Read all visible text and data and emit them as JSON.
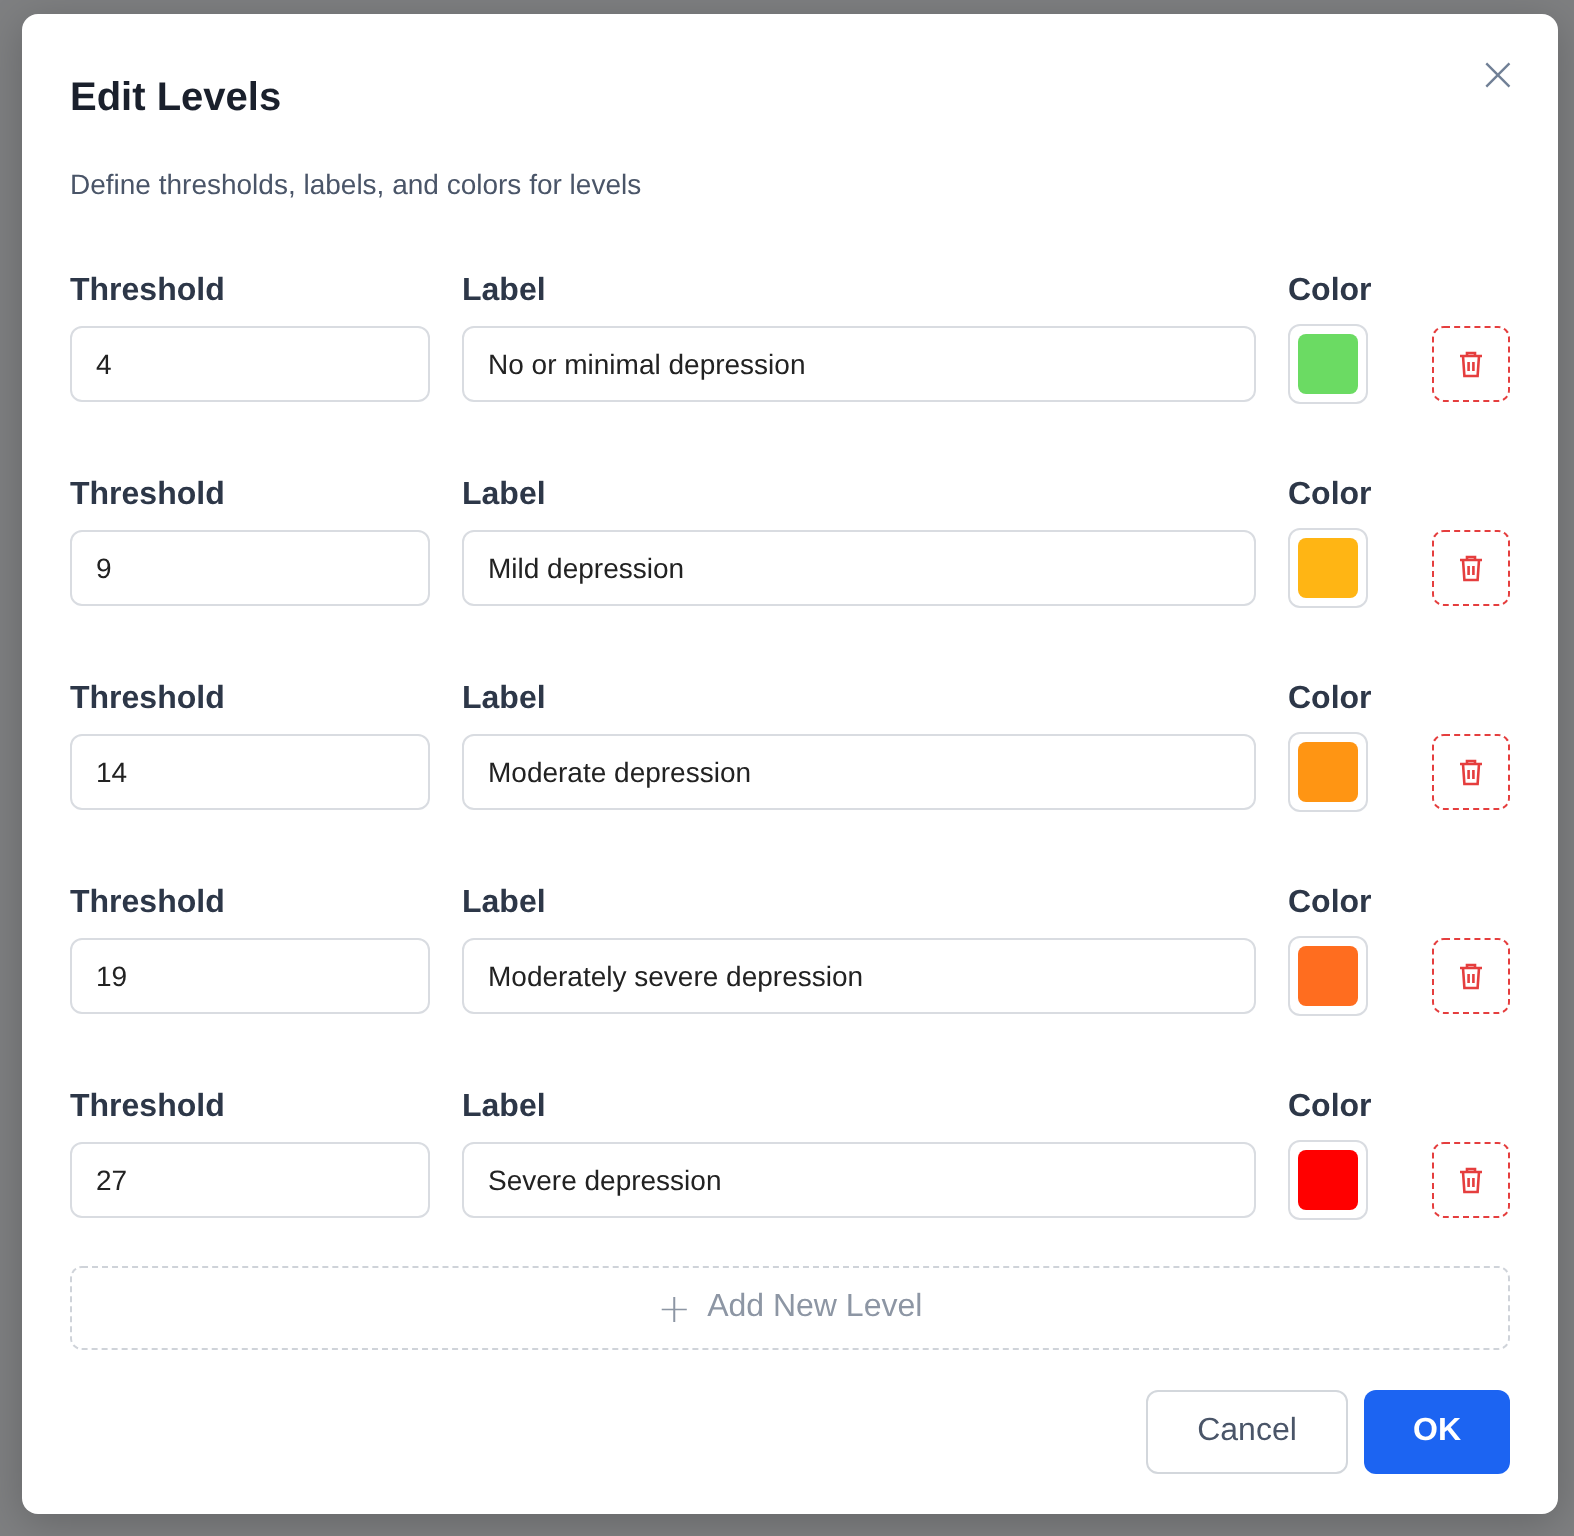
{
  "dialog": {
    "title": "Edit Levels",
    "subtitle": "Define thresholds, labels, and colors for levels",
    "close_icon": "×"
  },
  "levels": [
    {
      "threshold_heading": "Threshold",
      "label_heading": "Label",
      "color_heading": "Color",
      "threshold": "4",
      "label": "No or minimal depression",
      "color": "#6bdb63"
    },
    {
      "threshold_heading": "Threshold",
      "label_heading": "Label",
      "color_heading": "Color",
      "threshold": "9",
      "label": "Mild depression",
      "color": "#ffb514"
    },
    {
      "threshold_heading": "Threshold",
      "label_heading": "Label",
      "color_heading": "Color",
      "threshold": "14",
      "label": "Moderate depression",
      "color": "#ff9513"
    },
    {
      "threshold_heading": "Threshold",
      "label_heading": "Label",
      "color_heading": "Color",
      "threshold": "19",
      "label": "Moderately severe depression",
      "color": "#ff6d1f"
    },
    {
      "threshold_heading": "Threshold",
      "label_heading": "Label",
      "color_heading": "Color",
      "threshold": "27",
      "label": "Severe depression",
      "color": "#ff0000"
    }
  ],
  "add_button": {
    "icon": "+",
    "label": "Add New Level"
  },
  "buttons": [
    {
      "label": "Cancel",
      "kind": "secondary"
    },
    {
      "label": "OK",
      "kind": "primary"
    }
  ]
}
